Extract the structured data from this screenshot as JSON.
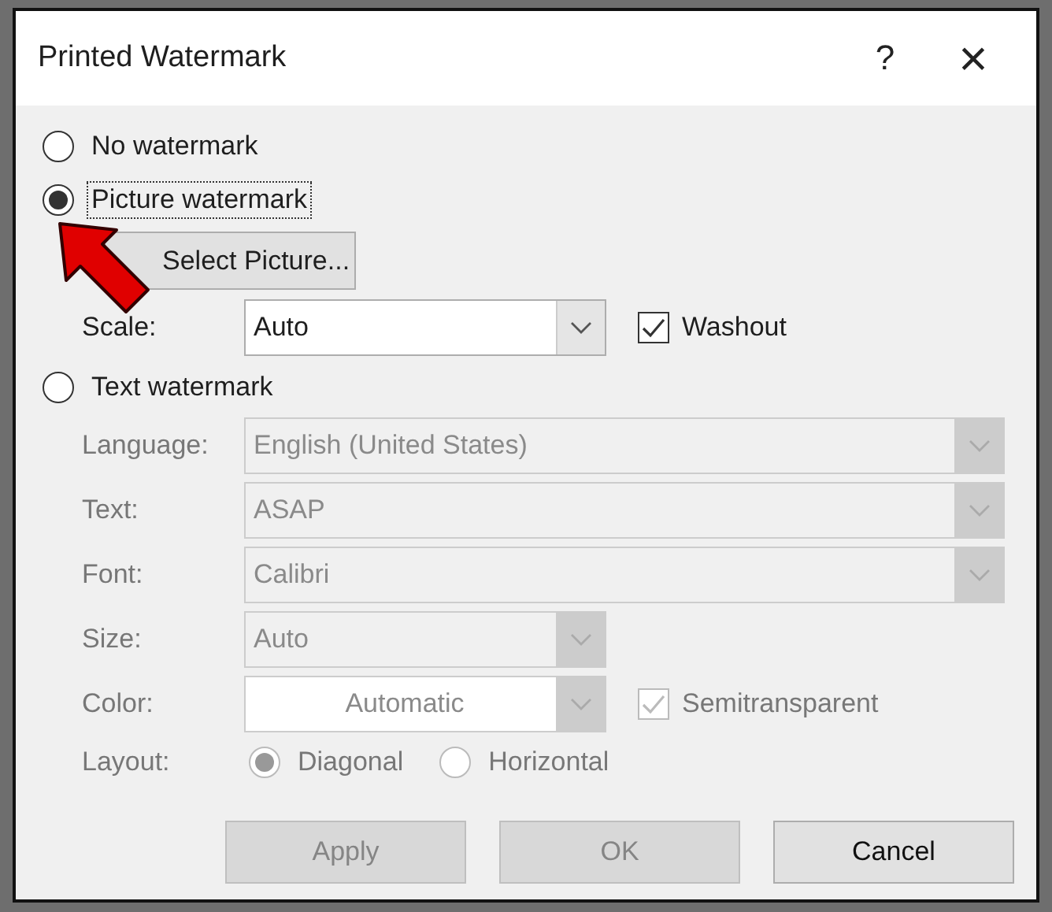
{
  "window": {
    "title": "Printed Watermark",
    "help": "?",
    "close": "×"
  },
  "no_watermark": {
    "label": "No watermark",
    "selected": false
  },
  "picture_watermark": {
    "label": "Picture watermark",
    "selected": true,
    "focused": true,
    "select_button": "Select Picture...",
    "scale": {
      "label": "Scale:",
      "value": "Auto"
    },
    "washout": {
      "label": "Washout",
      "checked": true
    }
  },
  "text_watermark": {
    "label": "Text watermark",
    "selected": false,
    "disabled": true,
    "fields": [
      {
        "label": "Language:",
        "value": "English (United States)",
        "kind": "wide"
      },
      {
        "label": "Text:",
        "value": "ASAP",
        "kind": "wide"
      },
      {
        "label": "Font:",
        "value": "Calibri",
        "kind": "wide"
      },
      {
        "label": "Size:",
        "value": "Auto",
        "kind": "narrow"
      },
      {
        "label": "Color:",
        "value": "Automatic",
        "kind": "color"
      }
    ],
    "semitransparent": {
      "label": "Semitransparent",
      "checked": true
    },
    "layout": {
      "label": "Layout:",
      "options": [
        {
          "label": "Diagonal",
          "selected": true
        },
        {
          "label": "Horizontal",
          "selected": false
        }
      ]
    }
  },
  "buttons": [
    {
      "label": "Apply",
      "disabled": true
    },
    {
      "label": "OK",
      "disabled": true
    },
    {
      "label": "Cancel",
      "disabled": false
    }
  ]
}
